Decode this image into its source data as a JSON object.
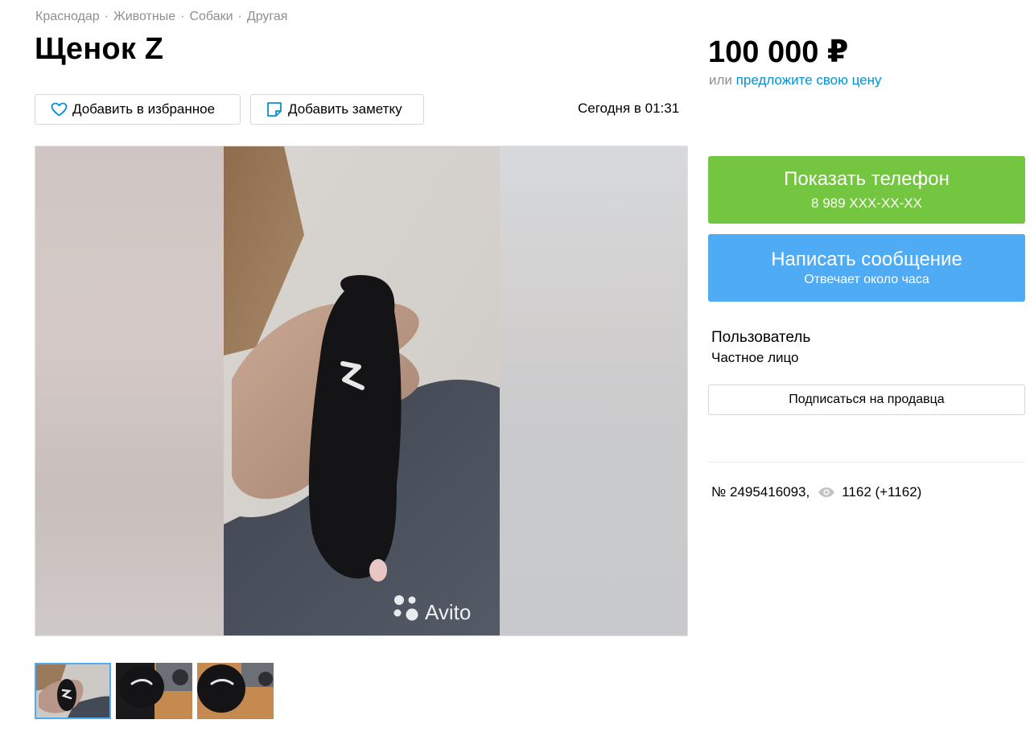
{
  "breadcrumb": [
    "Краснодар",
    "Животные",
    "Собаки",
    "Другая"
  ],
  "breadcrumb_separator": "·",
  "title": "Щенок Z",
  "actions": {
    "favorite_label": "Добавить в избранное",
    "note_label": "Добавить заметку"
  },
  "published": "Сегодня в 01:31",
  "gallery": {
    "watermark": "Avito",
    "thumbnails_count": 3,
    "active_index": 0
  },
  "price": {
    "value": "100 000 ₽",
    "offer_prefix": "или",
    "offer_link": "предложите свою цену"
  },
  "contact": {
    "phone_label": "Показать телефон",
    "phone_masked": "8 989 XXX-XX-XX",
    "message_label": "Написать сообщение",
    "message_sub": "Отвечает около часа"
  },
  "seller": {
    "name": "Пользователь",
    "type": "Частное лицо",
    "subscribe_label": "Подписаться на продавца"
  },
  "listing": {
    "number": "№ 2495416093,",
    "views": "1162 (+1162)"
  },
  "colors": {
    "green": "#74c540",
    "blue": "#4fabf3",
    "link": "#0091d9",
    "muted": "#8f8f8f"
  },
  "icons": [
    "heart-icon",
    "note-icon",
    "eye-icon",
    "avito-logo-icon"
  ]
}
